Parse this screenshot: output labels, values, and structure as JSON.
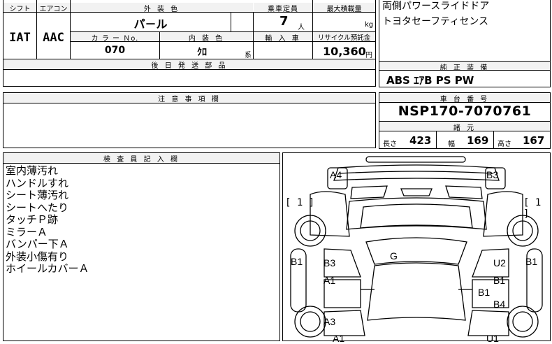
{
  "top_table": {
    "shift_label": "シフト",
    "aircon_label": "エアコン",
    "shift_value": "IAT",
    "aircon_value": "AAC",
    "exterior_color_label": "外 装 色",
    "exterior_color_value": "パ－ル",
    "capacity_label": "乗車定員",
    "capacity_value": "7",
    "capacity_unit": "人",
    "max_load_label": "最大積載量",
    "max_load_unit": "kg",
    "color_no_label": "カ ラ ー Ｎo.",
    "color_no_value": "070",
    "interior_color_label": "内 装 色",
    "interior_color_value": "ｸﾛ",
    "interior_color_suffix": "系",
    "import_label": "輸 入 車",
    "recycle_label": "リサイクル預託金",
    "recycle_value": "10,360",
    "recycle_unit": "円",
    "later_parts_label": "後 日 発 送 部 品"
  },
  "options": {
    "line1": "両側パワースライドドア",
    "line2": "トヨタセーフティセンス"
  },
  "genuine_equipment": {
    "label": "純 正 装 備",
    "value": "ABS ｴｱB PS PW"
  },
  "notes": {
    "label": "注 意 事 項 欄"
  },
  "chassis": {
    "label": "車 台 番 号",
    "value": "NSP170-7070761",
    "specs_label": "諸 元",
    "length_label": "長さ",
    "length_value": "423",
    "width_label": "幅",
    "width_value": "169",
    "height_label": "高さ",
    "height_value": "167"
  },
  "inspector": {
    "label": "検 査 員 記 入 欄",
    "remarks": [
      "室内薄汚れ",
      "ハンドルすれ",
      "シート薄汚れ",
      "シートへたり",
      "タッチＰ跡",
      "ミラーＡ",
      "バンパー下Ａ",
      "外装小傷有り",
      "ホイールカバーＡ"
    ]
  },
  "diagram": {
    "marks": {
      "a4": "A4",
      "b3_top": "B3",
      "left_bracket": "[ 1 ]",
      "right_bracket": "[ 1 ]",
      "b1_left": "B1",
      "b1_right": "B1",
      "g": "G",
      "b3_mid": "B3",
      "a1_left": "A1",
      "u2": "U2",
      "b1_r1": "B1",
      "b1_center": "B1",
      "b4": "B4",
      "a3": "A3",
      "a1_bottom": "A1",
      "u1": "U1"
    }
  }
}
